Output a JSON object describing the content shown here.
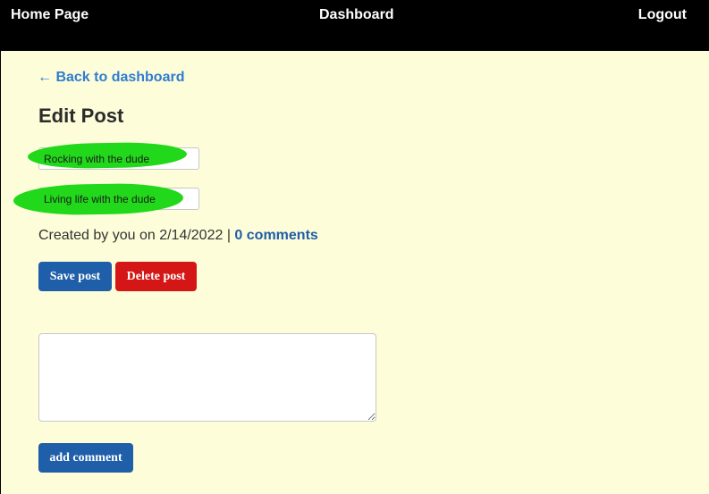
{
  "navbar": {
    "home": "Home Page",
    "dashboard": "Dashboard",
    "logout": "Logout"
  },
  "back_link": "← Back to dashboard",
  "page_title": "Edit Post",
  "form": {
    "title_value": "Rocking with the dude",
    "body_value": "Living life with the dude"
  },
  "meta": {
    "created_text": "Created by you on 2/14/2022 | ",
    "comments_link": "0 comments"
  },
  "buttons": {
    "save": "Save post",
    "delete": "Delete post",
    "add_comment": "add comment"
  },
  "comment_box": {
    "value": "",
    "placeholder": ""
  },
  "colors": {
    "navbar_bg": "#000000",
    "page_bg": "#fdfdd9",
    "primary": "#1f5ea8",
    "danger": "#d41616",
    "highlight": "#22d81a",
    "link": "#2f7dd1"
  }
}
